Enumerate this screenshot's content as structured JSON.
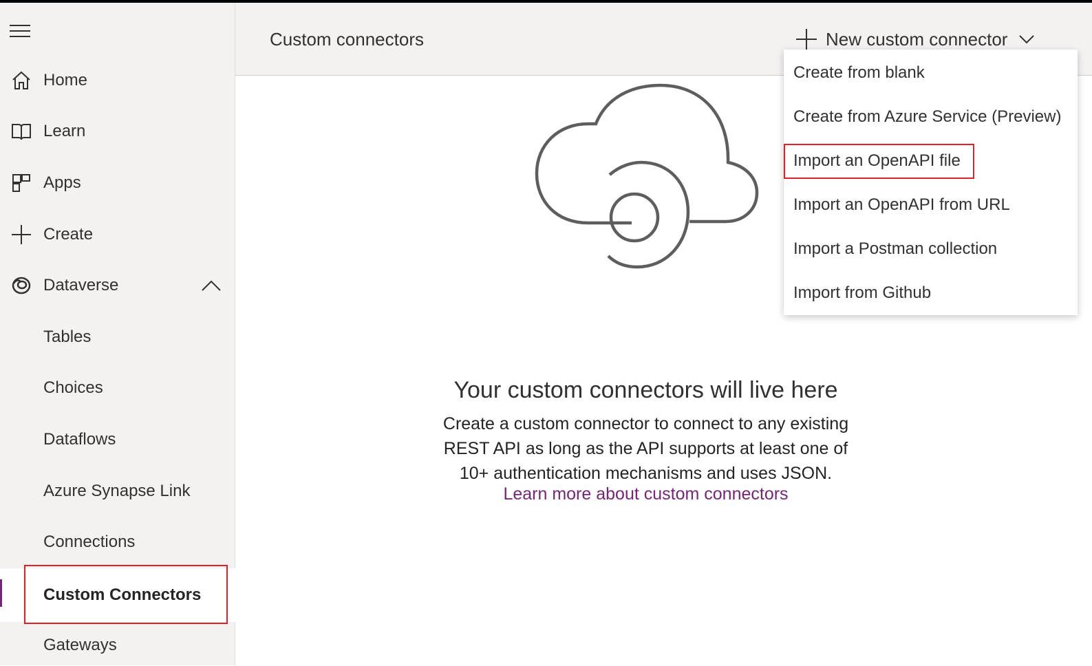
{
  "sidebar": {
    "items": [
      {
        "label": "Home",
        "icon": "home-icon"
      },
      {
        "label": "Learn",
        "icon": "book-icon"
      },
      {
        "label": "Apps",
        "icon": "apps-icon"
      },
      {
        "label": "Create",
        "icon": "plus-icon"
      },
      {
        "label": "Dataverse",
        "icon": "dataverse-icon",
        "expanded": true
      },
      {
        "label": "Tables"
      },
      {
        "label": "Choices"
      },
      {
        "label": "Dataflows"
      },
      {
        "label": "Azure Synapse Link"
      },
      {
        "label": "Connections"
      },
      {
        "label": "Custom Connectors",
        "selected": true
      },
      {
        "label": "Gateways"
      }
    ]
  },
  "header": {
    "title": "Custom connectors",
    "new_button_label": "New custom connector"
  },
  "dropdown": {
    "items": [
      "Create from blank",
      "Create from Azure Service (Preview)",
      "Import an OpenAPI file",
      "Import an OpenAPI from URL",
      "Import a Postman collection",
      "Import from Github"
    ]
  },
  "empty_state": {
    "title": "Your custom connectors will live here",
    "description_lines": [
      "Create a custom connector to connect to any existing",
      "REST API as long as the API supports at least one of",
      "10+ authentication mechanisms and uses JSON."
    ],
    "link": "Learn more about custom connectors"
  },
  "colors": {
    "accent": "#742774",
    "highlight": "#e31e24",
    "sidebar_bg": "#f3f2f1"
  }
}
